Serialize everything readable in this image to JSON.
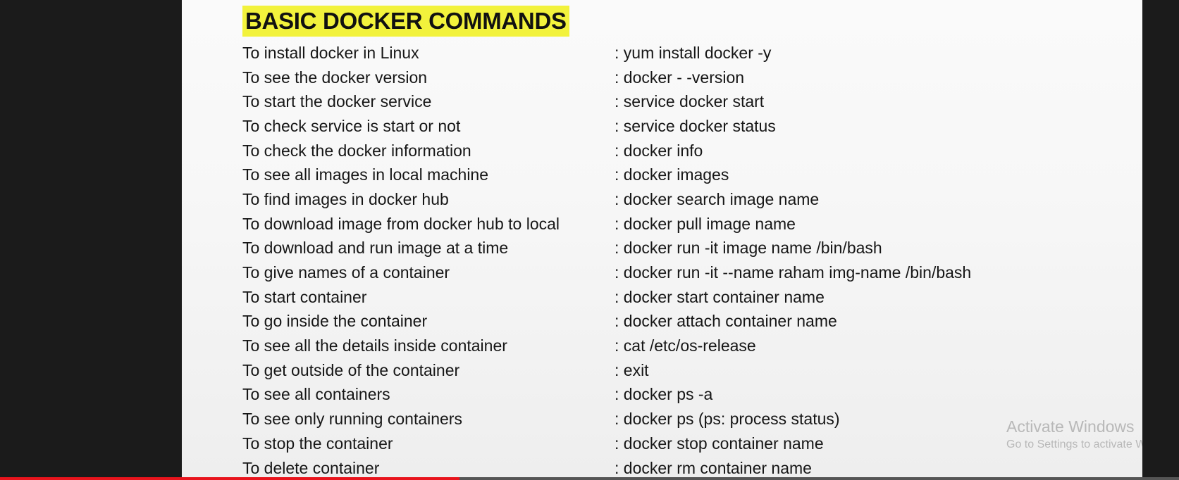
{
  "slide": {
    "title": "BASIC DOCKER COMMANDS",
    "rows": [
      {
        "desc": "To install docker in Linux",
        "cmd": ": yum install docker -y"
      },
      {
        "desc": "To see the docker version",
        "cmd": ": docker - -version"
      },
      {
        "desc": "To start the docker service",
        "cmd": ": service docker start"
      },
      {
        "desc": "To check service is start or not",
        "cmd": ": service docker status"
      },
      {
        "desc": "To check the docker information",
        "cmd": ": docker info"
      },
      {
        "desc": "To see all images in local machine",
        "cmd": ": docker images"
      },
      {
        "desc": "To find images in docker hub",
        "cmd": ": docker search image name"
      },
      {
        "desc": "To download image from docker hub to local",
        "cmd": ": docker pull image name"
      },
      {
        "desc": "To download and run image at a time",
        "cmd": ": docker run -it image name /bin/bash"
      },
      {
        "desc": "To give names of a container",
        "cmd": ": docker run -it --name raham img-name /bin/bash"
      },
      {
        "desc": "To start container",
        "cmd": ": docker start container name"
      },
      {
        "desc": "To go inside the container",
        "cmd": ": docker attach container name"
      },
      {
        "desc": "To see all the details inside container",
        "cmd": ": cat /etc/os-release"
      },
      {
        "desc": "To get outside of the container",
        "cmd": ": exit"
      },
      {
        "desc": "To see all containers",
        "cmd": ": docker ps -a"
      },
      {
        "desc": "To see only running containers",
        "cmd": ": docker ps (ps: process status)"
      },
      {
        "desc": "To stop the container",
        "cmd": ": docker stop container name"
      },
      {
        "desc": "To delete container",
        "cmd": ": docker rm container name"
      }
    ]
  },
  "watermark": {
    "title": "Activate Windows",
    "subtitle": "Go to Settings to activate Windows."
  },
  "video_progress": {
    "fraction": 0.39,
    "color": "#e8141c"
  }
}
